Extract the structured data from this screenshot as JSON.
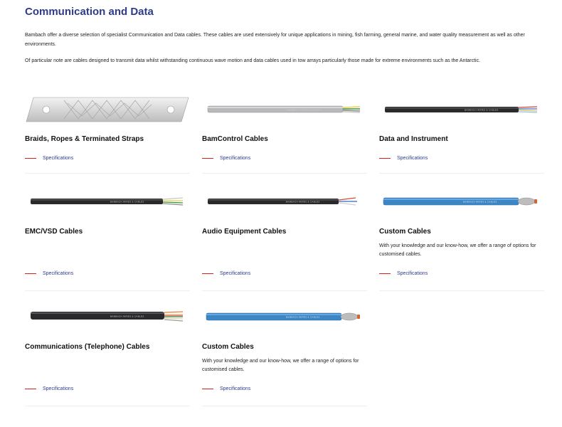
{
  "page": {
    "title": "Communication and Data",
    "intro_1": "Bambach offer a diverse selection of specialist Communication and Data cables. These cables are used extensively for unique applications in mining, fish farming, general marine, and water quality measurement as well as other environments.",
    "intro_2": "Of particular note are cables designed to transmit data whilst withstanding continuous wave motion and data cables used in tow arrays particularly those made for extreme environments such as the Antarctic."
  },
  "products": [
    {
      "name": "Braids, Ropes & Terminated Straps",
      "link": "Specifications",
      "image": "braided-strap-image"
    },
    {
      "name": "BamControl Cables",
      "link": "Specifications",
      "image": "grey-cable-image",
      "cable_color": "#b9b9bb",
      "cable_text": "BAMBACH WIRES & CABLES"
    },
    {
      "name": "Data and Instrument",
      "link": "Specifications",
      "image": "black-cable-image",
      "cable_color": "#2a2a2c",
      "cable_text": "BAMBACH WIRES & CABLES"
    },
    {
      "name": "EMC/VSD Cables",
      "link": "Specifications",
      "image": "black-cable-image",
      "cable_color": "#2a2a2c",
      "cable_text": "BAMBACH WIRES & CABLES"
    },
    {
      "name": "Audio Equipment Cables",
      "link": "Specifications",
      "image": "black-cable-image",
      "cable_color": "#2a2a2c",
      "cable_text": "BAMBACH WIRES & CABLES"
    },
    {
      "name": "Custom Cables",
      "desc": "With your knowledge and our know-how, we offer a range of options for customised cables.",
      "link": "Specifications",
      "image": "blue-cable-image",
      "cable_color": "#3d86c6",
      "cable_text": "BAMBACH WIRES & CABLES"
    },
    {
      "name": "Communications (Telephone) Cables",
      "link": "Specifications",
      "image": "black-cable-image",
      "cable_color": "#2a2a2c",
      "cable_text": "BAMBACH WIRES & CABLES"
    },
    {
      "name": "Custom Cables",
      "desc": "With your knowledge and our know-how, we offer a range of options for customised cables.",
      "link": "Specifications",
      "image": "blue-cable-image",
      "cable_color": "#3d86c6",
      "cable_text": "BAMBACH WIRES & CABLES"
    }
  ]
}
